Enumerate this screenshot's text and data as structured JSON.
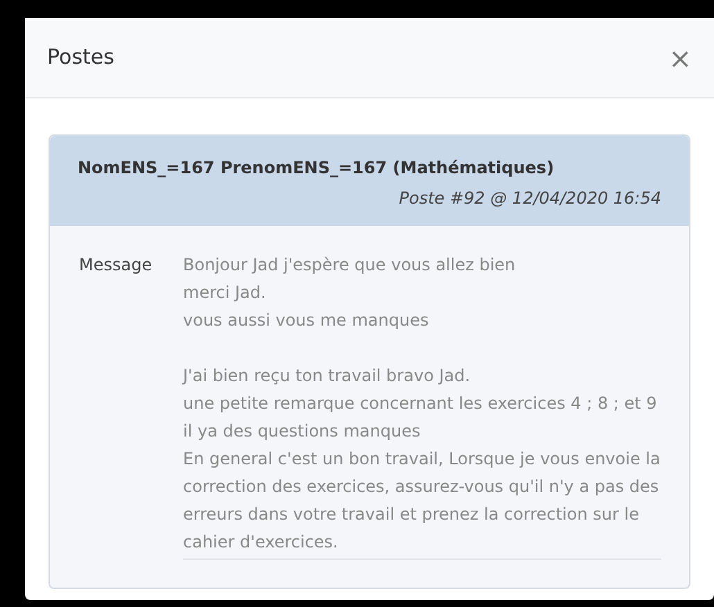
{
  "modal": {
    "title": "Postes",
    "close": "×"
  },
  "post": {
    "author": "NomENS_=167 PrenomENS_=167 (Mathématiques)",
    "meta": "Poste #92 @ 12/04/2020 16:54",
    "label": "Message",
    "paragraphs": [
      [
        "Bonjour Jad j'espère que vous allez bien",
        "merci Jad.",
        "vous aussi vous me manques"
      ],
      [
        "J'ai bien reçu ton travail bravo Jad.",
        "une petite remarque concernant les exercices 4 ; 8 ; et 9 il ya des questions manques",
        "En general c'est un bon travail, Lorsque je vous envoie la correction des exercices, assurez-vous qu'il n'y a pas des erreurs dans votre travail et prenez la correction sur le cahier d'exercices."
      ]
    ]
  }
}
